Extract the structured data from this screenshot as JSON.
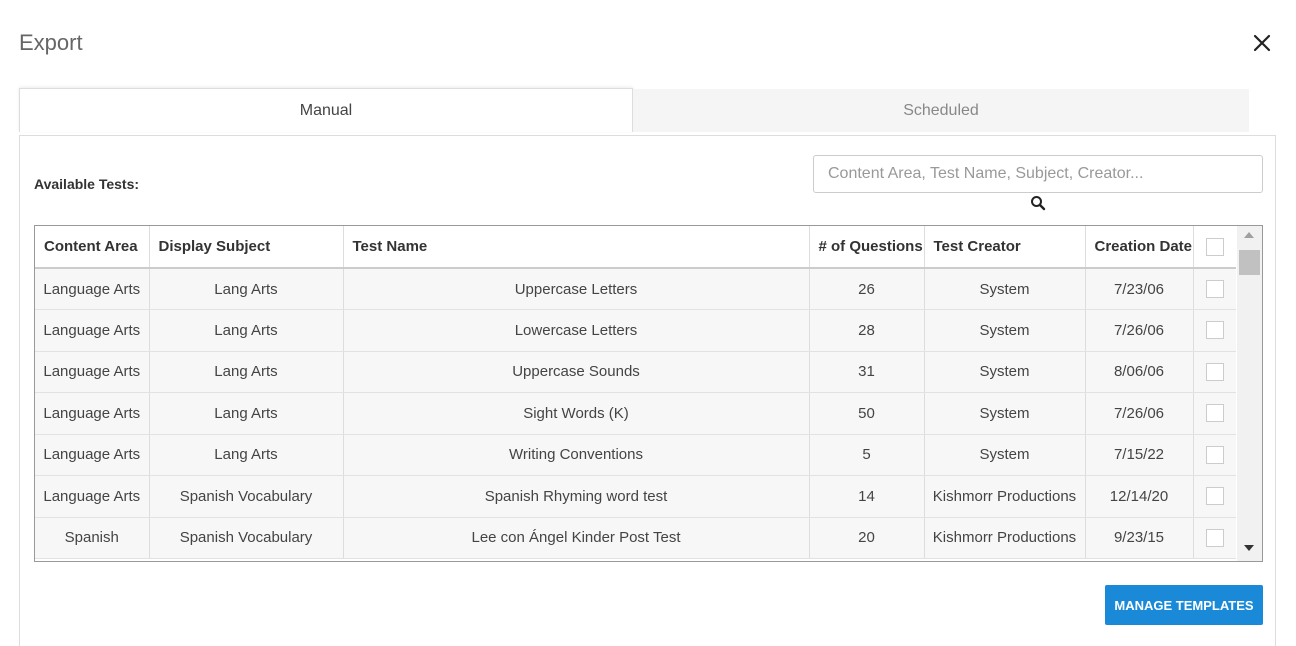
{
  "dialog": {
    "title": "Export"
  },
  "tabs": [
    {
      "label": "Manual",
      "active": true
    },
    {
      "label": "Scheduled",
      "active": false
    }
  ],
  "available_label": "Available Tests:",
  "search": {
    "placeholder": "Content Area, Test Name, Subject, Creator...",
    "value": ""
  },
  "table": {
    "headers": [
      "Content Area",
      "Display Subject",
      "Test Name",
      "# of Questions",
      "Test Creator",
      "Creation Date"
    ],
    "rows": [
      [
        "Language Arts",
        "Lang Arts",
        "Uppercase Letters",
        "26",
        "System",
        "7/23/06"
      ],
      [
        "Language Arts",
        "Lang Arts",
        "Lowercase Letters",
        "28",
        "System",
        "7/26/06"
      ],
      [
        "Language Arts",
        "Lang Arts",
        "Uppercase Sounds",
        "31",
        "System",
        "8/06/06"
      ],
      [
        "Language Arts",
        "Lang Arts",
        "Sight Words (K)",
        "50",
        "System",
        "7/26/06"
      ],
      [
        "Language Arts",
        "Lang Arts",
        "Writing Conventions",
        "5",
        "System",
        "7/15/22"
      ],
      [
        "Language Arts",
        "Spanish Vocabulary",
        "Spanish Rhyming word test",
        "14",
        "Kishmorr Productions",
        "12/14/20"
      ],
      [
        "Spanish",
        "Spanish Vocabulary",
        "Lee con Ángel Kinder Post Test",
        "20",
        "Kishmorr Productions",
        "9/23/15"
      ]
    ]
  },
  "buttons": {
    "manage_templates": "MANAGE TEMPLATES"
  },
  "colors": {
    "primary_button": "#1a8ad8",
    "row_background": "#f7f7f7"
  }
}
